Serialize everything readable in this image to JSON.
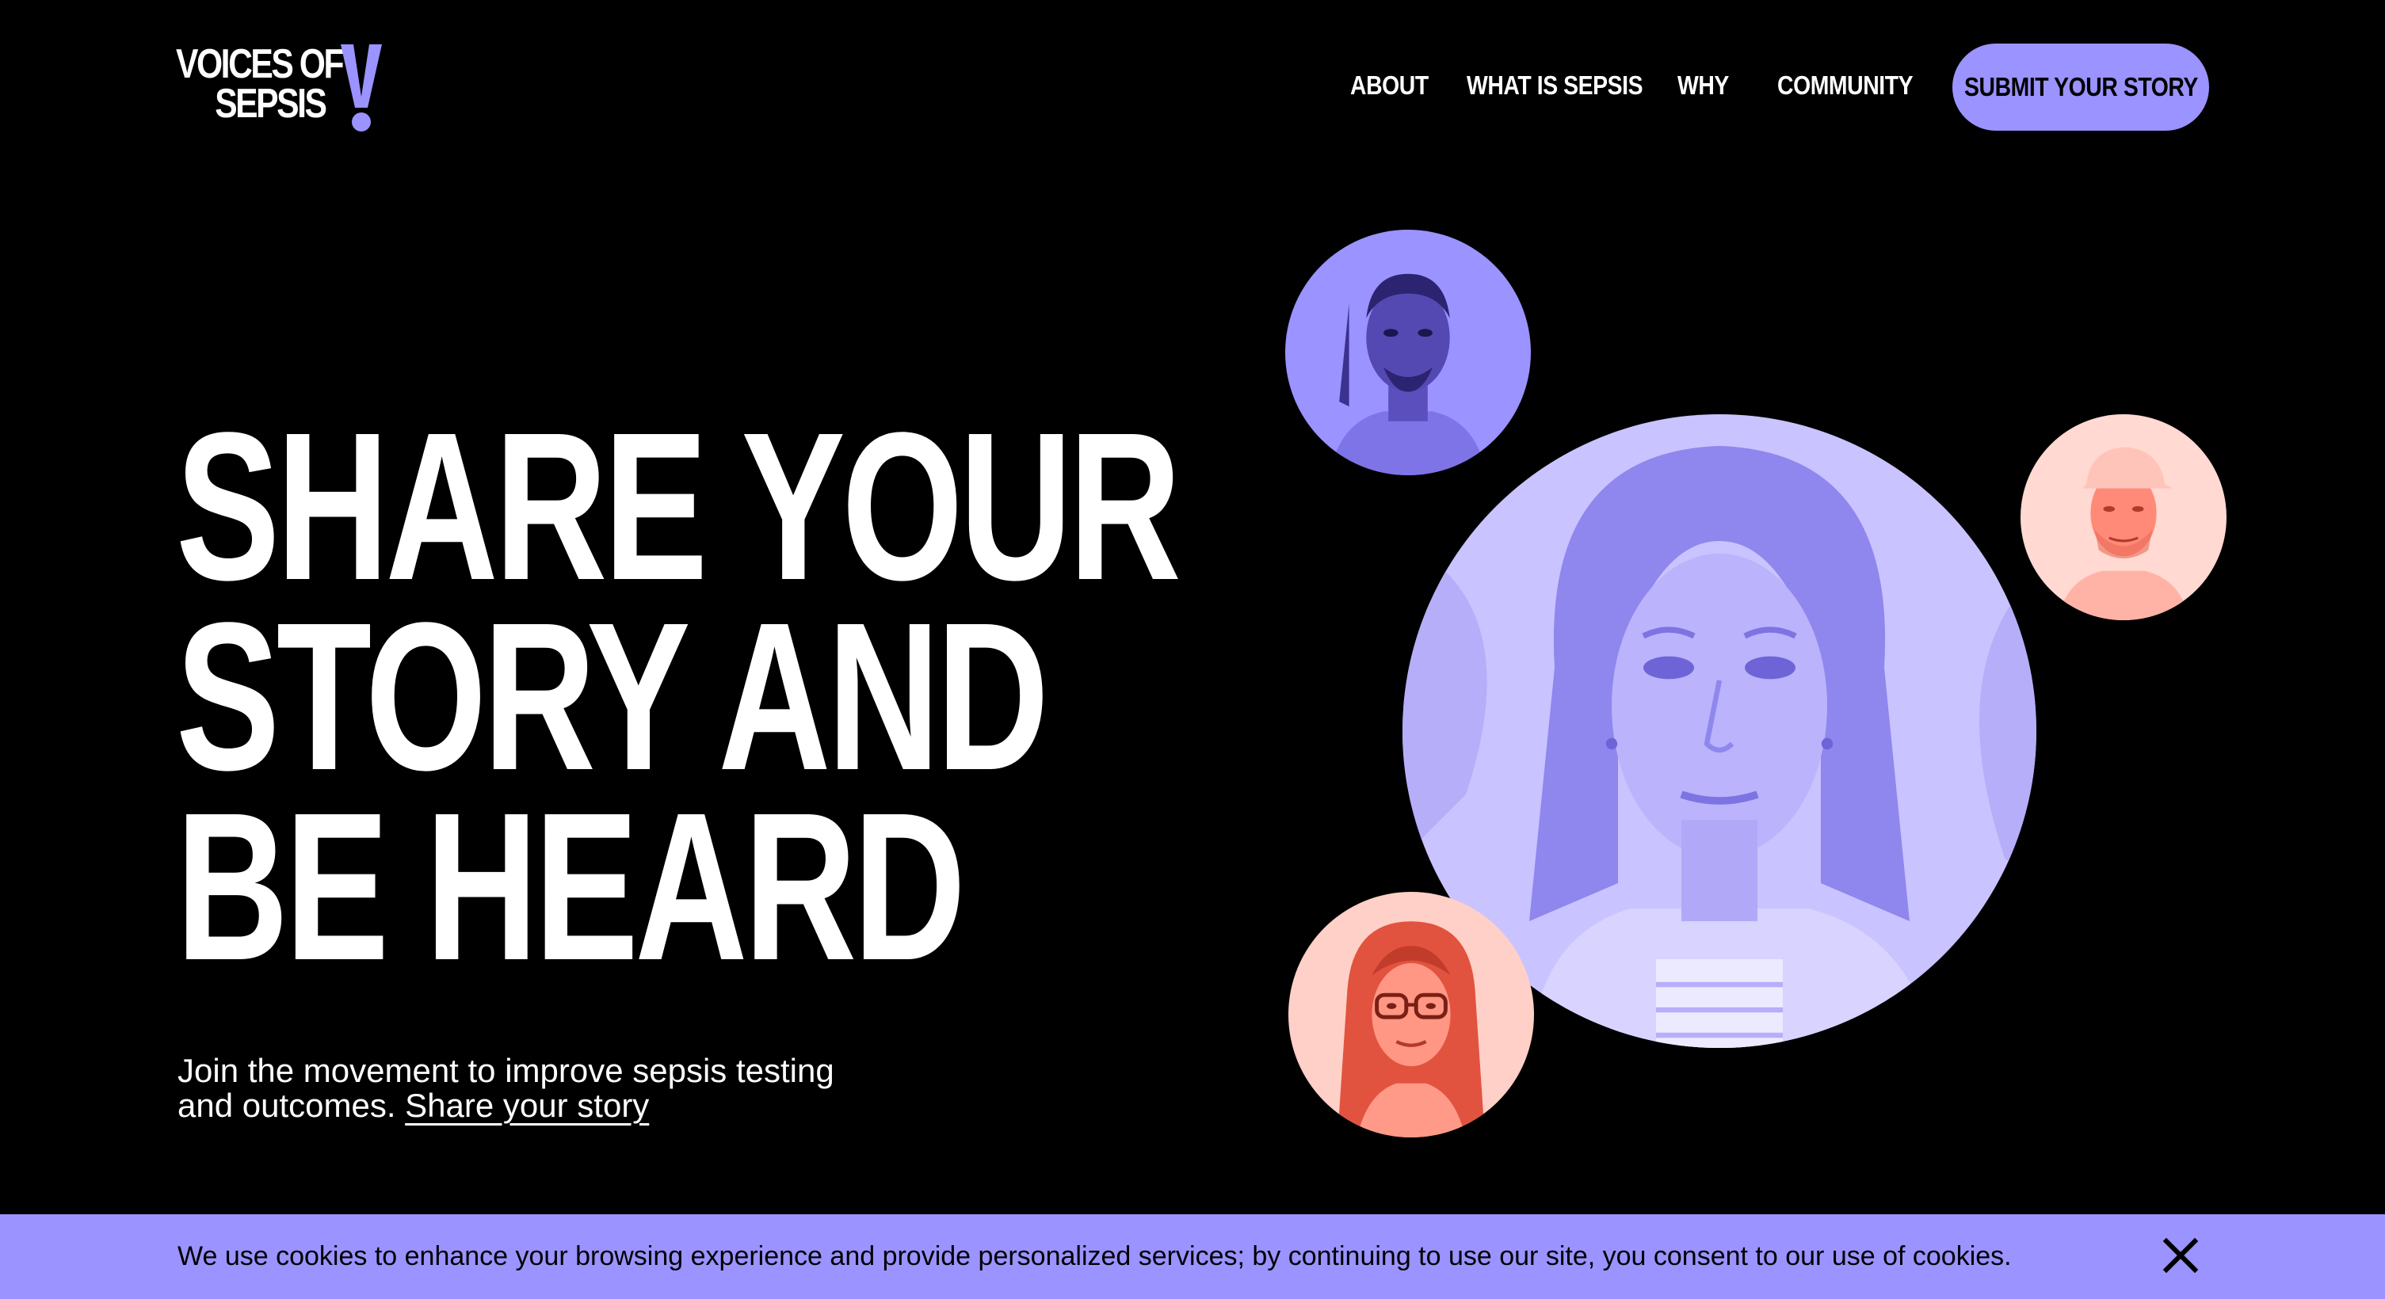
{
  "brand": {
    "logo_line1": "VOICES OF",
    "logo_line2": "SEPSIS",
    "logo_mark": "V!",
    "accent_color": "#9b93ff",
    "coral_color": "#ff6f5c"
  },
  "nav": {
    "items": [
      {
        "label": "ABOUT"
      },
      {
        "label": "WHAT IS SEPSIS"
      },
      {
        "label": "WHY"
      },
      {
        "label": "COMMUNITY"
      }
    ],
    "cta_label": "SUBMIT YOUR STORY"
  },
  "hero": {
    "title_lines": [
      "SHARE YOUR",
      "STORY AND",
      "BE HEARD"
    ],
    "subtitle": "Join the movement to improve sepsis testing and outcomes.",
    "subtitle_link": "Share your story"
  },
  "portraits": [
    {
      "name": "portrait-man-top",
      "tint": "purple"
    },
    {
      "name": "portrait-woman-center",
      "tint": "purple"
    },
    {
      "name": "portrait-man-cap",
      "tint": "coral"
    },
    {
      "name": "portrait-woman-glasses",
      "tint": "coral"
    }
  ],
  "cookie_banner": {
    "text": "We use cookies to enhance your browsing experience and provide personalized services; by continuing to use our site, you consent to our use of cookies.",
    "close_icon": "close-icon"
  }
}
